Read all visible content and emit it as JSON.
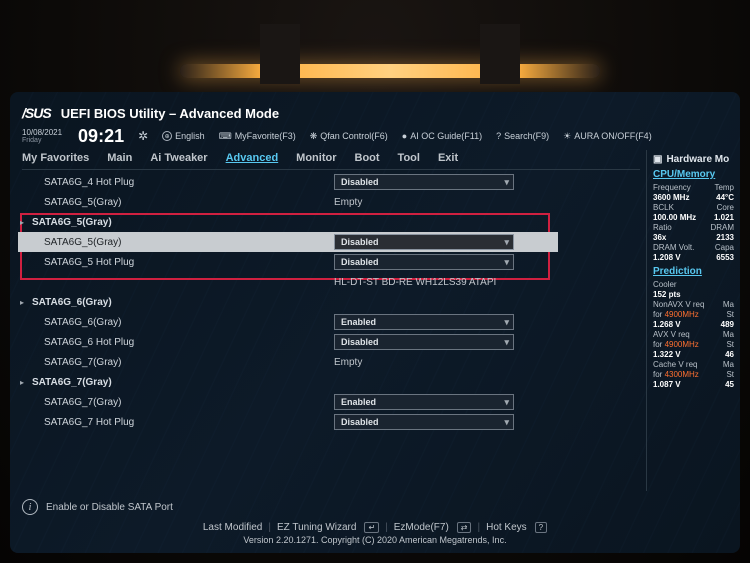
{
  "brand": "/SUS",
  "title": "UEFI BIOS Utility – Advanced Mode",
  "date": "10/08/2021",
  "day": "Friday",
  "time": "09:21",
  "topmenu": {
    "lang": "English",
    "fav": "MyFavorite(F3)",
    "qfan": "Qfan Control(F6)",
    "aioc": "AI OC Guide(F11)",
    "search": "Search(F9)",
    "aura": "AURA ON/OFF(F4)"
  },
  "tabs": [
    "My Favorites",
    "Main",
    "Ai Tweaker",
    "Advanced",
    "Monitor",
    "Boot",
    "Tool",
    "Exit"
  ],
  "active_tab": 3,
  "rows": [
    {
      "type": "item",
      "label": "SATA6G_4 Hot Plug",
      "ctl": "dd",
      "val": "Disabled"
    },
    {
      "type": "item",
      "label": "SATA6G_5(Gray)",
      "ctl": "txt",
      "val": "Empty"
    },
    {
      "type": "group",
      "label": "SATA6G_5(Gray)"
    },
    {
      "type": "item",
      "label": "SATA6G_5(Gray)",
      "ctl": "dd",
      "val": "Disabled",
      "selected": true
    },
    {
      "type": "item",
      "label": "SATA6G_5 Hot Plug",
      "ctl": "dd",
      "val": "Disabled"
    },
    {
      "type": "item",
      "label": "",
      "ctl": "txt",
      "val": "HL-DT-ST BD-RE  WH12LS39 ATAPI"
    },
    {
      "type": "group",
      "label": "SATA6G_6(Gray)"
    },
    {
      "type": "item",
      "label": "SATA6G_6(Gray)",
      "ctl": "dd",
      "val": "Enabled"
    },
    {
      "type": "item",
      "label": "SATA6G_6 Hot Plug",
      "ctl": "dd",
      "val": "Disabled"
    },
    {
      "type": "item",
      "label": "SATA6G_7(Gray)",
      "ctl": "txt",
      "val": "Empty"
    },
    {
      "type": "group",
      "label": "SATA6G_7(Gray)"
    },
    {
      "type": "item",
      "label": "SATA6G_7(Gray)",
      "ctl": "dd",
      "val": "Enabled"
    },
    {
      "type": "item",
      "label": "SATA6G_7 Hot Plug",
      "ctl": "dd",
      "val": "Disabled"
    }
  ],
  "help_text": "Enable or Disable SATA Port",
  "sidebar": {
    "head": "Hardware Mo",
    "cpu": {
      "title": "CPU/Memory",
      "freq_l": "Frequency",
      "freq_v": "3600 MHz",
      "temp_l": "Temp",
      "temp_v": "44°C",
      "bclk_l": "BCLK",
      "bclk_v": "100.00 MHz",
      "core_l": "Core",
      "core_v": "1.021",
      "ratio_l": "Ratio",
      "ratio_v": "36x",
      "dram_l": "DRAM",
      "dram_v": "2133",
      "dvolt_l": "DRAM Volt.",
      "dvolt_v": "1.208 V",
      "cap_l": "Capa",
      "cap_v": "6553"
    },
    "pred": {
      "title": "Prediction",
      "cooler_l": "Cooler",
      "cooler_v": "152 pts",
      "r1_l": "NonAVX V req",
      "r1_f": "for 4900MHz",
      "r1_v": "1.268 V",
      "r1_m": "489",
      "r2_l": "AVX V req",
      "r2_f": "for 4900MHz",
      "r2_v": "1.322 V",
      "r2_m": "46",
      "r3_l": "Cache V req",
      "r3_f": "for 4300MHz",
      "r3_v": "1.087 V",
      "r3_m": "45",
      "ma": "Ma",
      "st": "St"
    }
  },
  "footer": {
    "links": [
      "Last Modified",
      "EZ Tuning Wizard",
      "EzMode(F7)",
      "Hot Keys"
    ],
    "version": "Version 2.20.1271. Copyright (C) 2020 American Megatrends, Inc."
  }
}
